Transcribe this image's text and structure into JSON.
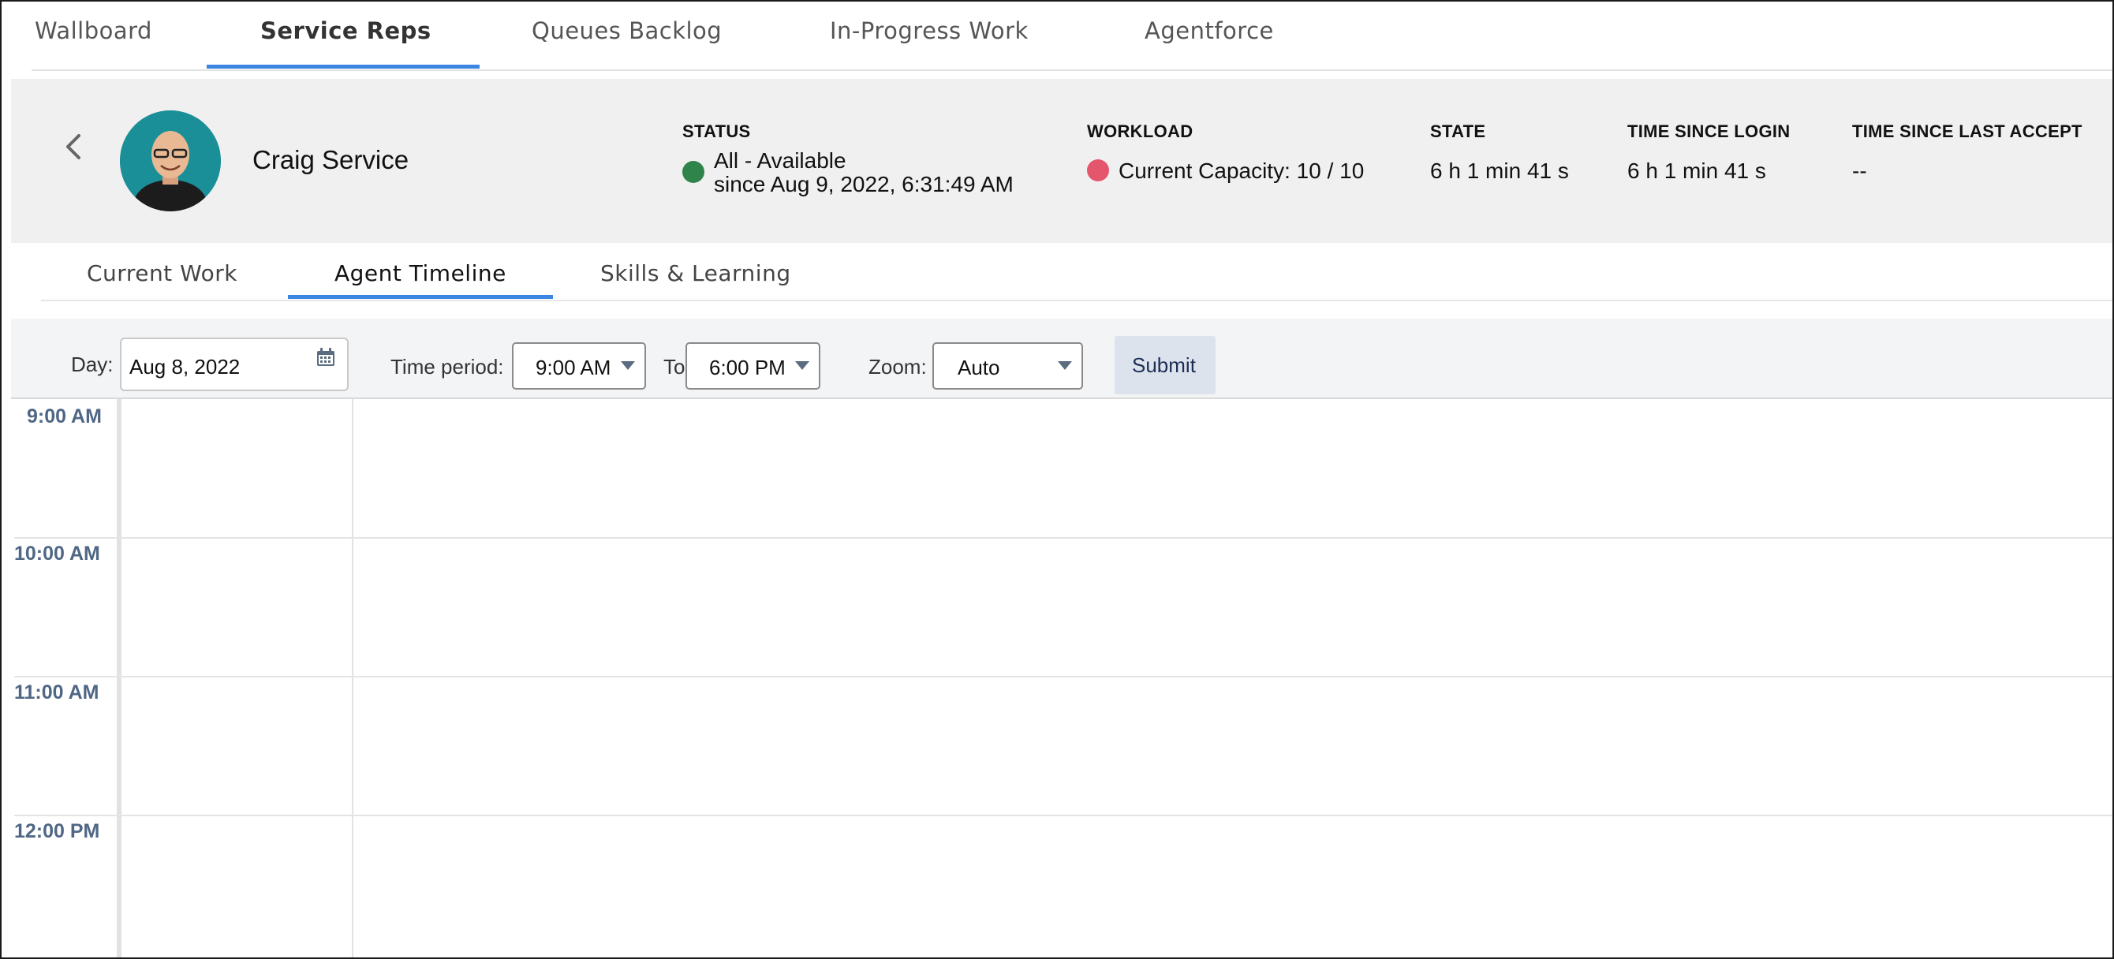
{
  "top_tabs": {
    "wallboard": "Wallboard",
    "service_reps": "Service Reps",
    "queues_backlog": "Queues Backlog",
    "in_progress": "In-Progress Work",
    "agentforce": "Agentforce"
  },
  "agent": {
    "name": "Craig Service",
    "status_label": "STATUS",
    "status_value": "All - Available",
    "status_since": "since  Aug 9, 2022, 6:31:49 AM",
    "status_color": "#2e844a",
    "workload_label": "WORKLOAD",
    "workload_value": "Current Capacity:  10 / 10",
    "workload_color": "#e4566b",
    "state_label": "STATE",
    "state_value": "6 h 1 min 41 s",
    "login_label": "TIME SINCE LOGIN",
    "login_value": "6 h 1 min 41 s",
    "accept_label": "TIME SINCE LAST ACCEPT",
    "accept_value": "--"
  },
  "sub_tabs": {
    "current_work": "Current Work",
    "agent_timeline": "Agent Timeline",
    "skills": "Skills & Learning"
  },
  "filters": {
    "day_label": "Day:",
    "day_value": "Aug 8, 2022",
    "period_label": "Time period:",
    "from_value": "9:00 AM",
    "to_label": "To",
    "to_value": "6:00 PM",
    "zoom_label": "Zoom:",
    "zoom_value": "Auto",
    "submit_label": "Submit"
  },
  "timeline": {
    "hours": [
      "9:00 AM",
      "10:00 AM",
      "11:00 AM",
      "12:00 PM"
    ]
  },
  "colors": {
    "accent": "#3b86e0",
    "time_label": "#4f6785"
  }
}
